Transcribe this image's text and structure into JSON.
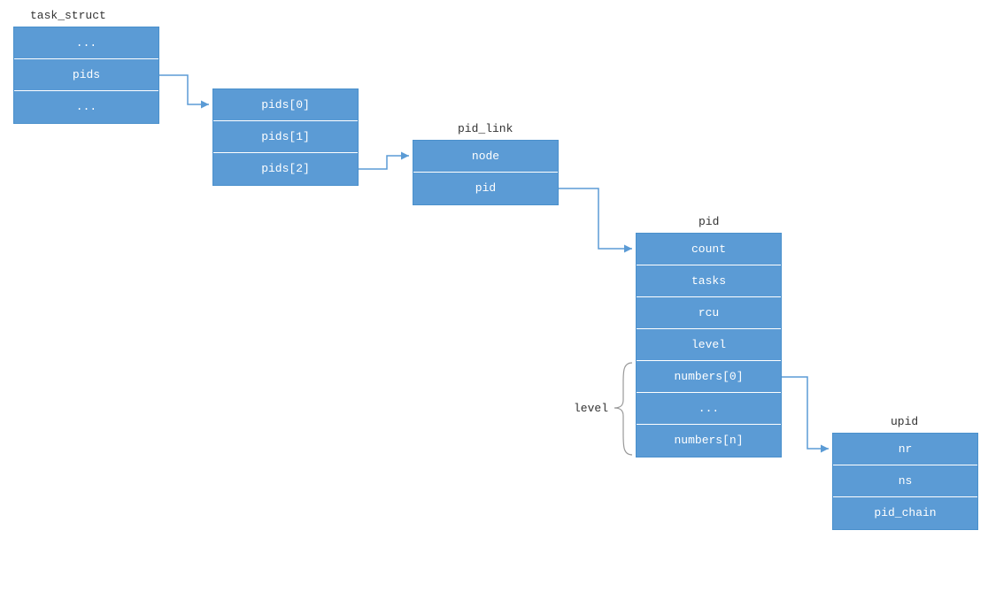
{
  "colors": {
    "box_fill": "#5b9bd5",
    "box_border": "#4a90cc",
    "text_on_box": "#ffffff",
    "title_text": "#333333",
    "arrow": "#5b9bd5",
    "brace": "#999999"
  },
  "structs": {
    "task_struct": {
      "title": "task_struct",
      "rows": [
        "...",
        "pids",
        "..."
      ]
    },
    "pids_array": {
      "rows": [
        "pids[0]",
        "pids[1]",
        "pids[2]"
      ]
    },
    "pid_link": {
      "title": "pid_link",
      "rows": [
        "node",
        "pid"
      ]
    },
    "pid": {
      "title": "pid",
      "rows": [
        "count",
        "tasks",
        "rcu",
        "level",
        "numbers[0]",
        "...",
        "numbers[n]"
      ]
    },
    "upid": {
      "title": "upid",
      "rows": [
        "nr",
        "ns",
        "pid_chain"
      ]
    }
  },
  "labels": {
    "level": "level"
  }
}
